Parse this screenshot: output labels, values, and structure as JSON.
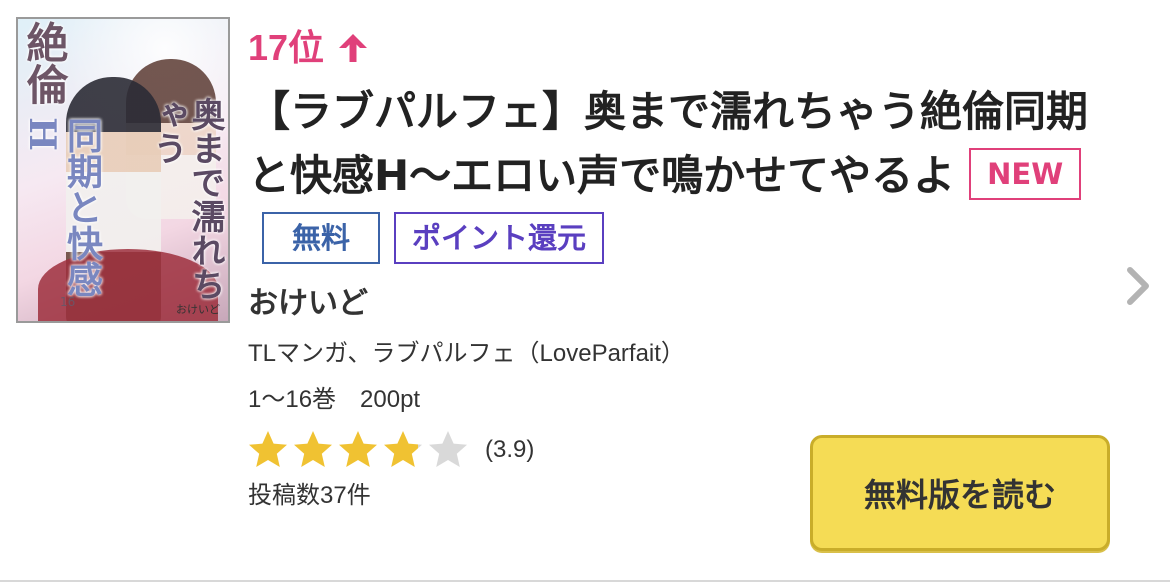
{
  "item": {
    "rank": "17位",
    "rank_change": "up",
    "title": "【ラブパルフェ】奥まで濡れちゃう絶倫同期と快感H〜エロい声で鳴かせてやるよ",
    "tags": {
      "new": "NEW",
      "free": "無料",
      "point": "ポイント還元"
    },
    "author": "おけいど",
    "genre": "TLマンガ、ラブパルフェ（LoveParfait）",
    "volumes": "1〜16巻　200pt",
    "rating": 3.9,
    "rating_text": "(3.9)",
    "reviews": "投稿数37件",
    "read_button": "無料版を読む"
  },
  "cover": {
    "text_left_big": "絶倫",
    "text_left_mid": "同期と快感H",
    "text_right": "奥まで濡れちゃう",
    "volume_mark": "16",
    "author": "おけいど"
  },
  "colors": {
    "rank": "#e0407a",
    "tag_new": "#e0407a",
    "tag_free": "#3b63a8",
    "tag_point": "#5a3fc0",
    "button_bg": "#f5dc55",
    "star_filled": "#f0c232",
    "star_empty": "#d9d9d9"
  },
  "icons": {
    "rank_arrow": "arrow-up-icon",
    "chevron": "chevron-right-icon",
    "star": "star-icon"
  }
}
